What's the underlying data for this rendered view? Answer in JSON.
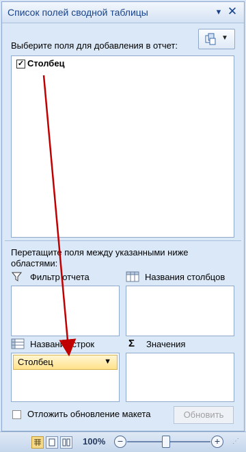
{
  "pane": {
    "title": "Список полей сводной таблицы",
    "title_dropdown_glyph": "▼",
    "close_glyph": "✕",
    "prompt": "Выберите поля для добавления в отчет:"
  },
  "field_list": [
    {
      "label": "Столбец",
      "checked": true
    }
  ],
  "layout_areas": {
    "hint": "Перетащите поля между указанными ниже областями:",
    "report_filter": {
      "label": "Фильтр отчета",
      "items": []
    },
    "column_labels": {
      "label": "Названия столбцов",
      "items": []
    },
    "row_labels": {
      "label": "Названия строк",
      "items": [
        "Столбец"
      ]
    },
    "values": {
      "label": "Значения",
      "icon_glyph": "Σ",
      "items": []
    }
  },
  "defer": {
    "label": "Отложить обновление макета",
    "checked": false
  },
  "update_button": "Обновить",
  "statusbar": {
    "zoom": "100%",
    "zoom_minus": "−",
    "zoom_plus": "+"
  },
  "annotation": {
    "arrow_color": "#c00000"
  }
}
